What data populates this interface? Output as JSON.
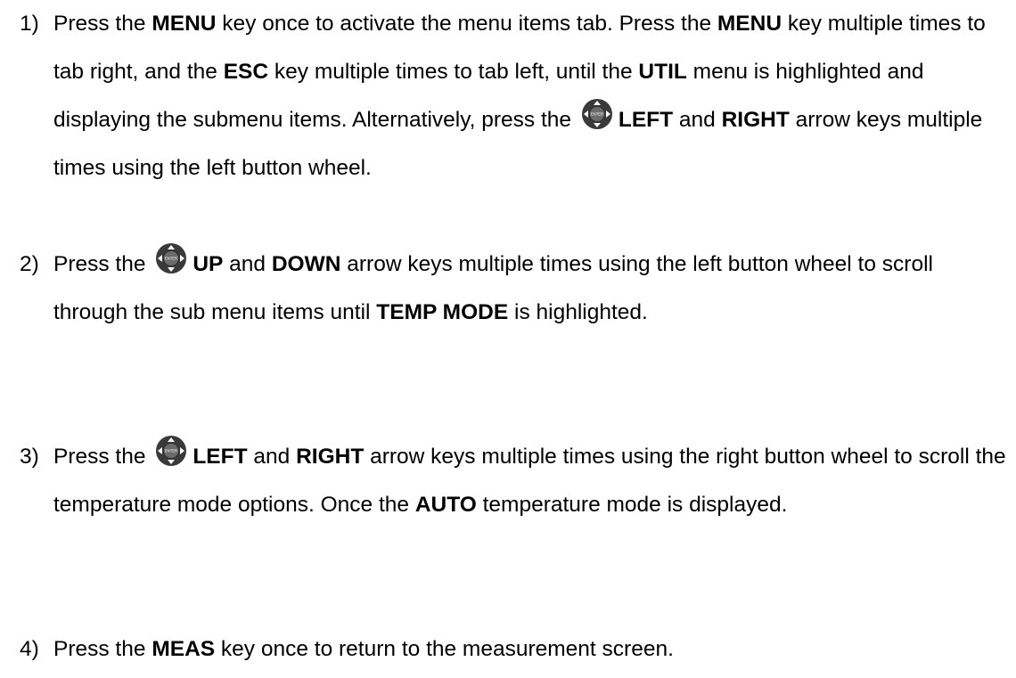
{
  "steps": [
    {
      "num": "1)",
      "parts": [
        [
          "Press the ",
          false
        ],
        [
          "MENU",
          true
        ],
        [
          " key once to activate the menu items tab.  Press the ",
          false
        ],
        [
          "MENU",
          true
        ],
        [
          " key multiple times to tab right, and the ",
          false
        ],
        [
          "ESC",
          true
        ],
        [
          " key multiple times to tab left, until the ",
          false
        ],
        [
          "UTIL",
          true
        ],
        [
          " menu is highlighted and displaying the submenu items. Alternatively, press the ",
          false
        ],
        [
          "@icon",
          false
        ],
        [
          "LEFT",
          true
        ],
        [
          " and ",
          false
        ],
        [
          "RIGHT",
          true
        ],
        [
          " arrow keys multiple times using the left button wheel.",
          false
        ]
      ]
    },
    {
      "num": "2)",
      "parts": [
        [
          "Press the ",
          false
        ],
        [
          "@icon",
          false
        ],
        [
          "UP",
          true
        ],
        [
          " and ",
          false
        ],
        [
          "DOWN",
          true
        ],
        [
          " arrow keys multiple times using the left button wheel to scroll through the sub menu items until ",
          false
        ],
        [
          "TEMP MODE",
          true
        ],
        [
          " is highlighted.",
          false
        ]
      ]
    },
    {
      "num": "3)",
      "parts": [
        [
          "Press the ",
          false
        ],
        [
          "@icon",
          false
        ],
        [
          "LEFT",
          true
        ],
        [
          " and ",
          false
        ],
        [
          "RIGHT",
          true
        ],
        [
          " arrow keys multiple times using the right button wheel to scroll the temperature mode options.  Once the ",
          false
        ],
        [
          "AUTO",
          true
        ],
        [
          " temperature mode is displayed.",
          false
        ]
      ]
    },
    {
      "num": "4)",
      "parts": [
        [
          "Press the ",
          false
        ],
        [
          "MEAS",
          true
        ],
        [
          " key once to return to the measurement screen.",
          false
        ]
      ]
    }
  ],
  "icon": {
    "name": "enter-button-wheel-icon",
    "label": "ENTER",
    "colors": {
      "outer": "#3a3a3a",
      "inner": "#6b6b6b",
      "arrow": "#ffffff"
    }
  }
}
